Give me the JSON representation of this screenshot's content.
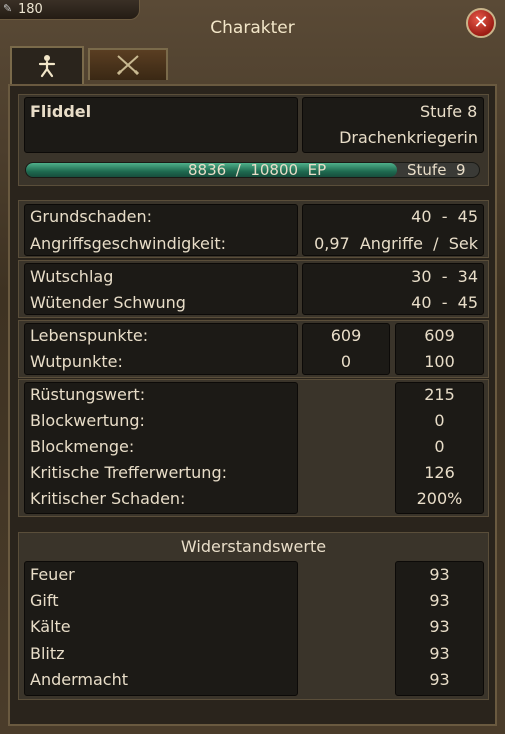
{
  "badge": {
    "value": "180"
  },
  "window": {
    "title": "Charakter"
  },
  "tabs": [
    {
      "name": "character-tab-icon"
    },
    {
      "name": "combat-tab-icon"
    }
  ],
  "header": {
    "name": "Fliddel",
    "level_label": "Stufe",
    "level_value": "8",
    "class": "Drachenkriegerin",
    "xp_current": "8836",
    "xp_separator": "/",
    "xp_max": "10800",
    "xp_unit": "EP",
    "next_level_label": "Stufe",
    "next_level_value": "9",
    "xp_progress": 0.818
  },
  "damage": {
    "base_damage_label": "Grundschaden:",
    "base_damage_min": "40",
    "base_damage_dash": "-",
    "base_damage_max": "45",
    "attack_speed_label": "Angriffsgeschwindigkeit:",
    "attack_speed_value": "0,97",
    "attack_speed_unit1": "Angriffe",
    "attack_speed_slash": "/",
    "attack_speed_unit2": "Sek"
  },
  "abilities": {
    "ability1_label": "Wutschlag",
    "ability1_min": "30",
    "ability1_dash": "-",
    "ability1_max": "34",
    "ability2_label": "Wütender Schwung",
    "ability2_min": "40",
    "ability2_dash": "-",
    "ability2_max": "45"
  },
  "resources": {
    "hp_label": "Lebenspunkte:",
    "hp_current": "609",
    "hp_max": "609",
    "rage_label": "Wutpunkte:",
    "rage_current": "0",
    "rage_max": "100"
  },
  "defense": {
    "armor_label": "Rüstungswert:",
    "armor_value": "215",
    "block_rating_label": "Blockwertung:",
    "block_rating_value": "0",
    "block_amount_label": "Blockmenge:",
    "block_amount_value": "0",
    "crit_rating_label": "Kritische Trefferwertung:",
    "crit_rating_value": "126",
    "crit_damage_label": "Kritischer Schaden:",
    "crit_damage_value": "200%"
  },
  "resistances": {
    "title": "Widerstandswerte",
    "fire_label": "Feuer",
    "fire_value": "93",
    "poison_label": "Gift",
    "poison_value": "93",
    "cold_label": "Kälte",
    "cold_value": "93",
    "lightning_label": "Blitz",
    "lightning_value": "93",
    "other_label": "Andermacht",
    "other_value": "93"
  },
  "colors": {
    "frame": "#4a3c2a",
    "panel": "#2a241c",
    "cell": "#1c1a16",
    "text": "#e8ddc8",
    "xp_bar": "#2f8a68",
    "close": "#c02a20"
  }
}
